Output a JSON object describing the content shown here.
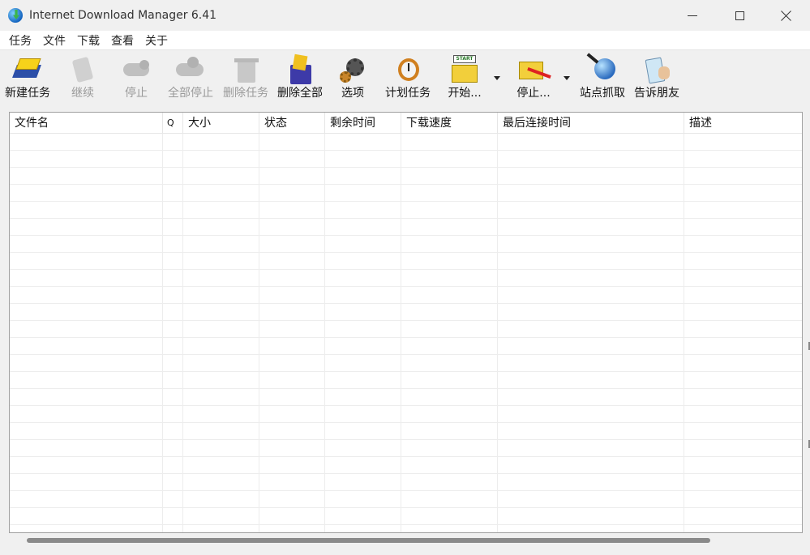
{
  "window": {
    "title": "Internet Download Manager 6.41"
  },
  "menu": [
    "任务",
    "文件",
    "下载",
    "查看",
    "关于"
  ],
  "toolbar": {
    "buttons": [
      {
        "label": "新建任务",
        "icon": "add-download-icon",
        "enabled": true
      },
      {
        "label": "继续",
        "icon": "resume-icon",
        "enabled": false
      },
      {
        "label": "停止",
        "icon": "stop-icon",
        "enabled": false
      },
      {
        "label": "全部停止",
        "icon": "stop-all-icon",
        "enabled": false
      },
      {
        "label": "删除任务",
        "icon": "delete-task-icon",
        "enabled": false
      },
      {
        "label": "删除全部",
        "icon": "delete-all-icon",
        "enabled": true
      },
      {
        "label": "选项",
        "icon": "options-gear-icon",
        "enabled": true
      },
      {
        "label": "计划任务",
        "icon": "scheduler-clock-icon",
        "enabled": true
      },
      {
        "label": "开始...",
        "icon": "start-queue-icon",
        "enabled": true
      },
      {
        "label": "停止...",
        "icon": "stop-queue-icon",
        "enabled": true
      },
      {
        "label": "站点抓取",
        "icon": "site-grabber-icon",
        "enabled": true
      },
      {
        "label": "告诉朋友",
        "icon": "tell-a-friend-icon",
        "enabled": true
      }
    ],
    "start_queue_badge": "START"
  },
  "list": {
    "columns": [
      "文件名",
      "Q",
      "大小",
      "状态",
      "剩余时间",
      "下载速度",
      "最后连接时间",
      "描述"
    ],
    "rows": []
  }
}
